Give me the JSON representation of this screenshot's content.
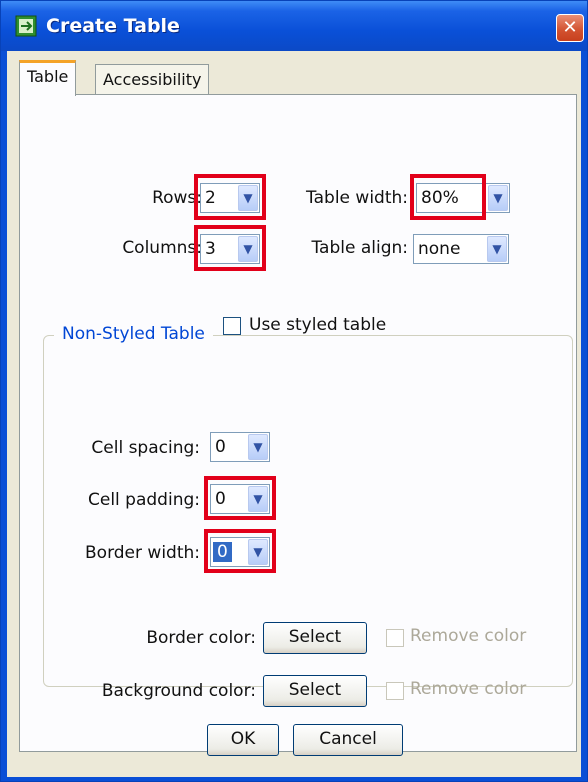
{
  "window": {
    "title": "Create Table",
    "close_glyph": "✕"
  },
  "tabs": [
    {
      "label": "Table",
      "active": true
    },
    {
      "label": "Accessibility",
      "active": false
    }
  ],
  "table_tab": {
    "rows": {
      "label": "Rows:",
      "value": "2"
    },
    "columns": {
      "label": "Columns:",
      "value": "3"
    },
    "table_width": {
      "label": "Table width:",
      "value": "80%"
    },
    "table_align": {
      "label": "Table align:",
      "value": "none"
    },
    "use_styled_table": {
      "label": "Use styled table",
      "checked": false
    }
  },
  "non_styled": {
    "legend": "Non-Styled Table",
    "cell_spacing": {
      "label": "Cell spacing:",
      "value": "0"
    },
    "cell_padding": {
      "label": "Cell padding:",
      "value": "0"
    },
    "border_width": {
      "label": "Border width:",
      "value": "0"
    },
    "border_color": {
      "label": "Border color:",
      "button": "Select",
      "remove_label": "Remove color"
    },
    "background_color": {
      "label": "Background color:",
      "button": "Select",
      "remove_label": "Remove color"
    }
  },
  "footer": {
    "ok": "OK",
    "cancel": "Cancel"
  },
  "colors": {
    "title_bar": "#0a50d8",
    "accent_highlight": "#e2001a",
    "dialog_bg": "#ece9d8",
    "group_legend": "#0046d5"
  }
}
